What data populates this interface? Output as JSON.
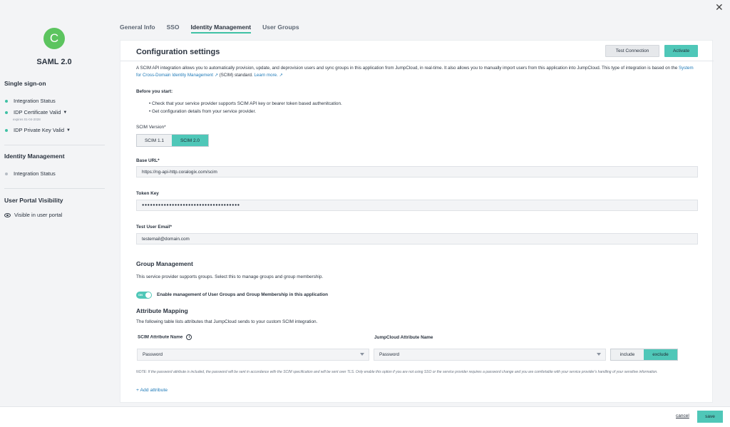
{
  "close_label": "✕",
  "sidebar": {
    "avatar_letter": "C",
    "app_name": "SAML 2.0",
    "single_sign_on": {
      "heading": "Single sign-on",
      "items": [
        {
          "label": "Integration Status"
        },
        {
          "label": "IDP Certificate Valid",
          "sub": "expires 01-04-2028"
        },
        {
          "label": "IDP Private Key Valid"
        }
      ]
    },
    "identity_management": {
      "heading": "Identity Management",
      "items": [
        {
          "label": "Integration Status"
        }
      ]
    },
    "user_portal": {
      "heading": "User Portal Visibility",
      "item": "Visible in user portal"
    }
  },
  "tabs": [
    {
      "label": "General Info"
    },
    {
      "label": "SSO"
    },
    {
      "label": "Identity Management"
    },
    {
      "label": "User Groups"
    }
  ],
  "main": {
    "title": "Configuration settings",
    "test_connection": "Test Connection",
    "activate": "Activate",
    "description_1": "A SCIM API integration allows you to automatically provision, update, and deprovision users and sync groups in this application from JumpCloud, in real-time. It also allows you to manually import users from this application into JumpCloud. This type of integration is based on the ",
    "description_link": "System for Cross-Domain Identity Management ↗",
    "description_2": " (SCIM) standard. ",
    "learn_more": "Learn more. ↗",
    "before_start": "Before you start:",
    "bullets": [
      "Check that your service provider supports SCIM API key or bearer token based authenitcation.",
      "Get configuration details from your service provider."
    ],
    "scim_version_label": "SCIM Version*",
    "scim_versions": [
      "SCIM 1.1",
      "SCIM 2.0"
    ],
    "base_url_label": "Base URL*",
    "base_url": "https://ng-api-http.coralogix.com/scim",
    "token_key_label": "Token Key",
    "token_key": "●●●●●●●●●●●●●●●●●●●●●●●●●●●●●●●●●●●●",
    "test_email_label": "Test User Email*",
    "test_email": "testemail@domain.com",
    "group_mgmt_heading": "Group Management",
    "group_mgmt_desc": "This service provider supports groups. Select this to manage groups and group membership.",
    "toggle_state": "ON",
    "toggle_label": "Enable management of User Groups and Group Membership in this application",
    "attr_heading": "Attribute Mapping",
    "attr_desc": "The following table lists attributes that JumpCloud sends to your custom SCIM integration.",
    "col_scim": "SCIM Attribute Name",
    "col_jc": "JumpCloud Attribute Name",
    "info_glyph": "i",
    "scim_attr_value": "Password",
    "jc_attr_value": "Password",
    "include": "include",
    "exclude": "exclude",
    "note": "NOTE: If the password attribute is included, the password will be sent in accordance with the SCIM specification and will be sent over TLS. Only enable this option if you are not using SSO or the service provider requires a password change and you are comfortable with your service provider's handling of your sensitive information.",
    "add_attribute": "+ Add attribute"
  },
  "footer": {
    "cancel": "cancel",
    "save": "save"
  },
  "colors": {
    "accent": "#4fc7b8",
    "avatar": "#5cc45f",
    "link": "#1f7ab8"
  }
}
